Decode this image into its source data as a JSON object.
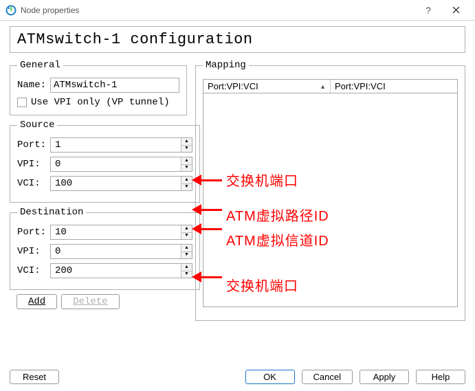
{
  "window": {
    "title": "Node properties"
  },
  "config_title": "ATMswitch-1 configuration",
  "general": {
    "legend": "General",
    "name_label": "Name:",
    "name_value": "ATMswitch-1",
    "use_vpi_label": "Use VPI only (VP tunnel)",
    "use_vpi_checked": false
  },
  "source": {
    "legend": "Source",
    "port_label": "Port:",
    "port_value": "1",
    "vpi_label": "VPI:",
    "vpi_value": "0",
    "vci_label": "VCI:",
    "vci_value": "100"
  },
  "destination": {
    "legend": "Destination",
    "port_label": "Port:",
    "port_value": "10",
    "vpi_label": "VPI:",
    "vpi_value": "0",
    "vci_label": "VCI:",
    "vci_value": "200"
  },
  "actions": {
    "add": "Add",
    "delete": "Delete"
  },
  "mapping": {
    "legend": "Mapping",
    "col1": "Port:VPI:VCI",
    "col2": "Port:VPI:VCI"
  },
  "footer": {
    "reset": "Reset",
    "ok": "OK",
    "cancel": "Cancel",
    "apply": "Apply",
    "help": "Help"
  },
  "annotations": {
    "a1": "交换机端口",
    "a2": "ATM虚拟路径ID",
    "a3": "ATM虚拟信道ID",
    "a4": "交换机端口"
  }
}
